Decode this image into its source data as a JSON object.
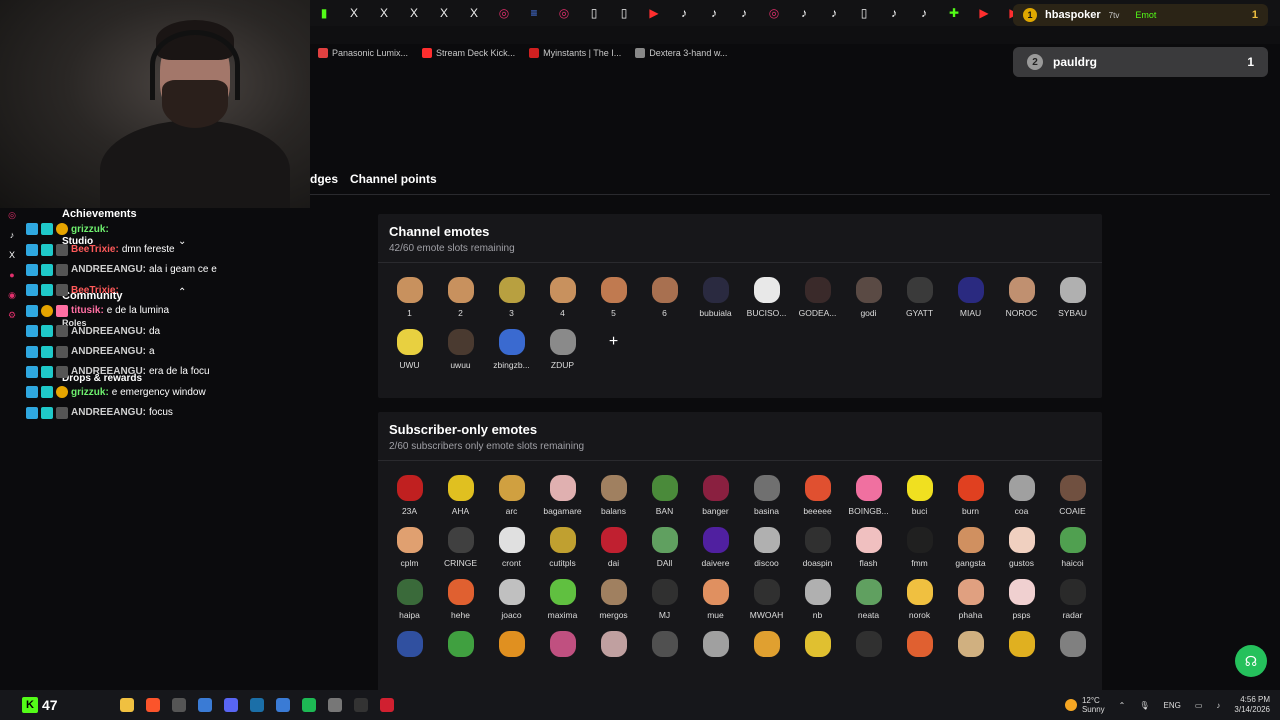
{
  "browser": {
    "tabs": [
      {
        "icon": "kick-icon",
        "glyph": "▮",
        "cls": "c-k"
      },
      {
        "icon": "x-icon",
        "glyph": "X",
        "cls": "c-x"
      },
      {
        "icon": "x-icon",
        "glyph": "X",
        "cls": "c-x"
      },
      {
        "icon": "x-icon",
        "glyph": "X",
        "cls": "c-x"
      },
      {
        "icon": "x-icon",
        "glyph": "X",
        "cls": "c-x"
      },
      {
        "icon": "x-icon",
        "glyph": "X",
        "cls": "c-x"
      },
      {
        "icon": "instagram-icon",
        "glyph": "◎",
        "cls": "c-ig"
      },
      {
        "icon": "docs-icon",
        "glyph": "≡",
        "cls": "c-doc"
      },
      {
        "icon": "instagram-icon",
        "glyph": "◎",
        "cls": "c-ig"
      },
      {
        "icon": "page-icon",
        "glyph": "▯",
        "cls": "c-x"
      },
      {
        "icon": "page-icon",
        "glyph": "▯",
        "cls": "c-x"
      },
      {
        "icon": "youtube-icon",
        "glyph": "▶",
        "cls": "c-yt"
      },
      {
        "icon": "tiktok-icon",
        "glyph": "♪",
        "cls": "c-tt"
      },
      {
        "icon": "tiktok-icon",
        "glyph": "♪",
        "cls": "c-tt"
      },
      {
        "icon": "tiktok-icon",
        "glyph": "♪",
        "cls": "c-tt"
      },
      {
        "icon": "instagram-icon",
        "glyph": "◎",
        "cls": "c-ig"
      },
      {
        "icon": "tiktok-icon",
        "glyph": "♪",
        "cls": "c-tt"
      },
      {
        "icon": "tiktok-icon",
        "glyph": "♪",
        "cls": "c-tt"
      },
      {
        "icon": "page-icon",
        "glyph": "▯",
        "cls": "c-x"
      },
      {
        "icon": "tiktok-icon",
        "glyph": "♪",
        "cls": "c-tt"
      },
      {
        "icon": "tiktok-icon",
        "glyph": "♪",
        "cls": "c-tt"
      },
      {
        "icon": "puzzle-icon",
        "glyph": "✚",
        "cls": "c-k"
      },
      {
        "icon": "youtube-icon",
        "glyph": "▶",
        "cls": "c-yt"
      },
      {
        "icon": "youtube-icon",
        "glyph": "▶",
        "cls": "c-yt"
      },
      {
        "icon": "steam-icon",
        "glyph": "◉",
        "cls": "c-steam"
      }
    ],
    "bookmarks": [
      {
        "label": "Panasonic Lumix...",
        "color": "#e04040"
      },
      {
        "label": "Stream Deck Kick...",
        "color": "#ff2e2e"
      },
      {
        "label": "Myinstants | The I...",
        "color": "#d02020"
      },
      {
        "label": "Dextera 3-hand w...",
        "color": "#888888"
      }
    ]
  },
  "overlay": {
    "top": {
      "rank": "1",
      "name": "hbaspoker",
      "tag": "7tv",
      "kick_label": "Emot",
      "count": "1"
    },
    "second": {
      "rank": "2",
      "name": "pauldrg",
      "count": "1"
    }
  },
  "sidenav": {
    "achievements": "Achievements",
    "studio": "Studio",
    "community": "Community",
    "roles": "Roles",
    "drops": "Drops & rewards"
  },
  "chat": [
    {
      "user": "grizzuk:",
      "color": "#6ef06e",
      "msg": "",
      "badges": [
        "b-blue",
        "b-cyan",
        "b-gold"
      ]
    },
    {
      "user": "BeeTrixie:",
      "color": "#ff5a5a",
      "msg": "dmn fereste",
      "badges": [
        "b-blue",
        "b-cyan",
        "b-grey"
      ]
    },
    {
      "user": "ANDREEANGU:",
      "color": "#d0d0d0",
      "msg": "ala i geam ce e",
      "badges": [
        "b-blue",
        "b-cyan",
        "b-grey"
      ]
    },
    {
      "user": "BeeTrixie:",
      "color": "#ff5a5a",
      "msg": "",
      "badges": [
        "b-blue",
        "b-cyan",
        "b-grey"
      ]
    },
    {
      "user": "titusik:",
      "color": "#ff6fa3",
      "msg": "e de la lumina",
      "badges": [
        "b-blue",
        "b-gold",
        "b-pink"
      ]
    },
    {
      "user": "ANDREEANGU:",
      "color": "#d0d0d0",
      "msg": "da",
      "badges": [
        "b-blue",
        "b-cyan",
        "b-grey"
      ]
    },
    {
      "user": "ANDREEANGU:",
      "color": "#d0d0d0",
      "msg": "a",
      "badges": [
        "b-blue",
        "b-cyan",
        "b-grey"
      ]
    },
    {
      "user": "ANDREEANGU:",
      "color": "#d0d0d0",
      "msg": "era de la focu",
      "badges": [
        "b-blue",
        "b-cyan",
        "b-grey"
      ]
    },
    {
      "user": "grizzuk:",
      "color": "#6ef06e",
      "msg": "e emergency window",
      "badges": [
        "b-blue",
        "b-cyan",
        "b-gold"
      ]
    },
    {
      "user": "ANDREEANGU:",
      "color": "#d0d0d0",
      "msg": "focus",
      "badges": [
        "b-blue",
        "b-cyan",
        "b-grey"
      ]
    }
  ],
  "page_tabs": {
    "badges": "dges",
    "channel_points": "Channel points"
  },
  "channel_emotes": {
    "title": "Channel emotes",
    "subtitle": "42/60 emote slots remaining",
    "items": [
      {
        "label": "1",
        "color": "#c8915e"
      },
      {
        "label": "2",
        "color": "#c8915e"
      },
      {
        "label": "3",
        "color": "#b8a040"
      },
      {
        "label": "4",
        "color": "#c8915e"
      },
      {
        "label": "5",
        "color": "#c07a50"
      },
      {
        "label": "6",
        "color": "#a87050"
      },
      {
        "label": "bubuiala",
        "color": "#2a2a40"
      },
      {
        "label": "BUCISO...",
        "color": "#e8e8e8"
      },
      {
        "label": "GODEA...",
        "color": "#3a2a2a"
      },
      {
        "label": "godi",
        "color": "#5a4a44"
      },
      {
        "label": "GYATT",
        "color": "#3a3a3a"
      },
      {
        "label": "MIAU",
        "color": "#2a2a80"
      },
      {
        "label": "NOROC",
        "color": "#c09070"
      },
      {
        "label": "SYBAU",
        "color": "#b0b0b0"
      },
      {
        "label": "UWU",
        "color": "#e8d040"
      },
      {
        "label": "uwuu",
        "color": "#4a3a30"
      },
      {
        "label": "zbingzb...",
        "color": "#3a6ad0"
      },
      {
        "label": "ZDUP",
        "color": "#8a8a8a"
      }
    ]
  },
  "subscriber_emotes": {
    "title": "Subscriber-only emotes",
    "subtitle": "2/60 subscribers only emote slots remaining",
    "items": [
      {
        "label": "23A",
        "color": "#c02020"
      },
      {
        "label": "AHA",
        "color": "#e0c020"
      },
      {
        "label": "arc",
        "color": "#d0a040"
      },
      {
        "label": "bagamare",
        "color": "#e0b0b0"
      },
      {
        "label": "balans",
        "color": "#a08060"
      },
      {
        "label": "BAN",
        "color": "#4a8a3a"
      },
      {
        "label": "banger",
        "color": "#8a2040"
      },
      {
        "label": "basina",
        "color": "#707070"
      },
      {
        "label": "beeeee",
        "color": "#e05030"
      },
      {
        "label": "BOINGB...",
        "color": "#f070a0"
      },
      {
        "label": "buci",
        "color": "#f0e020"
      },
      {
        "label": "burn",
        "color": "#e04020"
      },
      {
        "label": "coa",
        "color": "#a0a0a0"
      },
      {
        "label": "COAIE",
        "color": "#705040"
      },
      {
        "label": "cplm",
        "color": "#e0a070"
      },
      {
        "label": "CRINGE",
        "color": "#404040"
      },
      {
        "label": "cront",
        "color": "#e0e0e0"
      },
      {
        "label": "cutitpls",
        "color": "#c0a030"
      },
      {
        "label": "dai",
        "color": "#c02030"
      },
      {
        "label": "DAll",
        "color": "#60a060"
      },
      {
        "label": "daivere",
        "color": "#5020a0"
      },
      {
        "label": "discoo",
        "color": "#b0b0b0"
      },
      {
        "label": "doaspin",
        "color": "#303030"
      },
      {
        "label": "flash",
        "color": "#f0c0c0"
      },
      {
        "label": "fmm",
        "color": "#202020"
      },
      {
        "label": "gangsta",
        "color": "#d09060"
      },
      {
        "label": "gustos",
        "color": "#f0d0c0"
      },
      {
        "label": "haicoi",
        "color": "#50a050"
      },
      {
        "label": "haipa",
        "color": "#3a6a3a"
      },
      {
        "label": "hehe",
        "color": "#e06030"
      },
      {
        "label": "joaco",
        "color": "#c0c0c0"
      },
      {
        "label": "maxima",
        "color": "#60c040"
      },
      {
        "label": "mergos",
        "color": "#a08060"
      },
      {
        "label": "MJ",
        "color": "#303030"
      },
      {
        "label": "mue",
        "color": "#e09060"
      },
      {
        "label": "MWOAH",
        "color": "#303030"
      },
      {
        "label": "nb",
        "color": "#b0b0b0"
      },
      {
        "label": "neata",
        "color": "#60a060"
      },
      {
        "label": "norok",
        "color": "#f0c040"
      },
      {
        "label": "phaha",
        "color": "#e0a080"
      },
      {
        "label": "psps",
        "color": "#f0d0d0"
      },
      {
        "label": "radar",
        "color": "#2a2a2a"
      },
      {
        "label": "",
        "color": "#3050a0"
      },
      {
        "label": "",
        "color": "#40a040"
      },
      {
        "label": "",
        "color": "#e09020"
      },
      {
        "label": "",
        "color": "#c05080"
      },
      {
        "label": "",
        "color": "#c0a0a0"
      },
      {
        "label": "",
        "color": "#505050"
      },
      {
        "label": "",
        "color": "#a0a0a0"
      },
      {
        "label": "",
        "color": "#e0a030"
      },
      {
        "label": "",
        "color": "#e0c030"
      },
      {
        "label": "",
        "color": "#303030"
      },
      {
        "label": "",
        "color": "#e06030"
      },
      {
        "label": "",
        "color": "#d0b080"
      },
      {
        "label": "",
        "color": "#e0b020"
      },
      {
        "label": "",
        "color": "#808080"
      }
    ]
  },
  "taskbar": {
    "viewer_count": "47",
    "apps": [
      {
        "icon": "file-explorer-icon",
        "color": "#f0c040"
      },
      {
        "icon": "brave-icon",
        "color": "#fb542b"
      },
      {
        "icon": "obs-icon",
        "color": "#555555"
      },
      {
        "icon": "store-icon",
        "color": "#3a7bd5"
      },
      {
        "icon": "discord-icon",
        "color": "#5865f2"
      },
      {
        "icon": "steam-icon",
        "color": "#1b6fa8"
      },
      {
        "icon": "teams-icon",
        "color": "#3a7bd5"
      },
      {
        "icon": "spotify-icon",
        "color": "#1db954"
      },
      {
        "icon": "settings-icon",
        "color": "#777777"
      },
      {
        "icon": "github-icon",
        "color": "#333333"
      },
      {
        "icon": "opera-icon",
        "color": "#d02030"
      }
    ],
    "weather": {
      "temp": "12°C",
      "cond": "Sunny"
    },
    "lang": "ENG",
    "time": "4:56 PM",
    "date": "3/14/2026"
  }
}
